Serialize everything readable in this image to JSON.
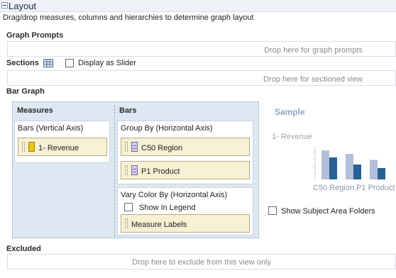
{
  "header": {
    "title": "Layout",
    "description": "Drag/drop measures, columns and hierarchies to determine graph layout"
  },
  "graph_prompts": {
    "title": "Graph Prompts",
    "drop_text": "Drop here for graph prompts"
  },
  "sections": {
    "title": "Sections",
    "slider_label": "Display as Slider",
    "drop_text": "Drop here for sectioned view"
  },
  "bar_graph": {
    "title": "Bar Graph",
    "measures": {
      "heading": "Measures",
      "axis_label": "Bars (Vertical Axis)",
      "chip": "1- Revenue"
    },
    "bars": {
      "heading": "Bars",
      "group_label": "Group By (Horizontal Axis)",
      "group_chips": [
        "C50 Region",
        "P1 Product"
      ],
      "vary_label": "Vary Color By (Horizontal Axis)",
      "legend_label": "Show In Legend",
      "vary_chip": "Measure Labels"
    }
  },
  "sample": {
    "title": "Sample",
    "y_label": "1- Revenue",
    "x_label": "C50 Region,P1 Product",
    "colors": {
      "light": "#b3bfd9",
      "dark": "#2a5f94"
    },
    "bar_levels": [
      {
        "light": 0.82,
        "dark": 0.62
      },
      {
        "light": 0.72,
        "dark": 0.42
      },
      {
        "light": 0.55,
        "dark": 0.32
      }
    ]
  },
  "show_subject_area_folders": "Show Subject Area Folders",
  "excluded": {
    "title": "Excluded",
    "drop_text": "Drop here to exclude from this view only"
  }
}
